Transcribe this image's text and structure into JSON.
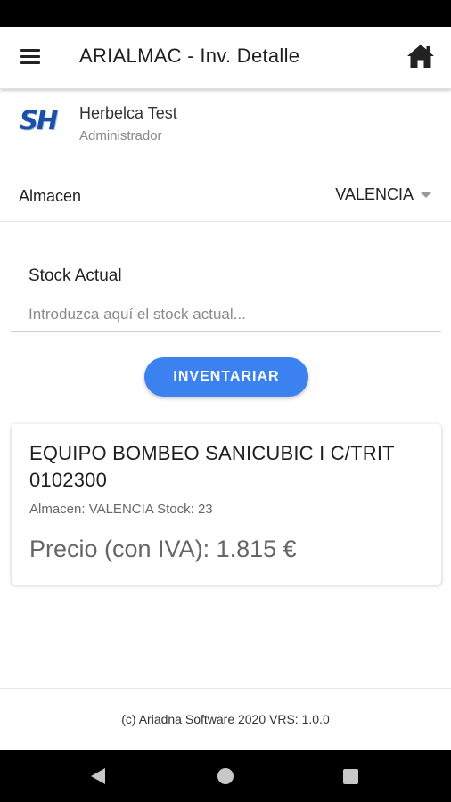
{
  "app_bar": {
    "title": "ARIALMAC - Inv. Detalle",
    "menu_icon": "hamburger-menu-icon",
    "home_icon": "home-icon"
  },
  "user": {
    "logo_text": "SH",
    "name": "Herbelca Test",
    "role": "Administrador"
  },
  "almacen": {
    "label": "Almacen",
    "selected": "VALENCIA"
  },
  "stock": {
    "label": "Stock Actual",
    "placeholder": "Introduzca aquí el stock actual..."
  },
  "button": {
    "label": "INVENTARIAR"
  },
  "product": {
    "title": "EQUIPO BOMBEO SANICUBIC I C/TRIT 0102300",
    "detail": "Almacen: VALENCIA Stock: 23",
    "price": "Precio (con IVA): 1.815 €"
  },
  "footer": {
    "text": "(c) Ariadna Software 2020 VRS: 1.0.0"
  },
  "colors": {
    "accent": "#3b82f0",
    "logo": "#1d4fa6"
  }
}
